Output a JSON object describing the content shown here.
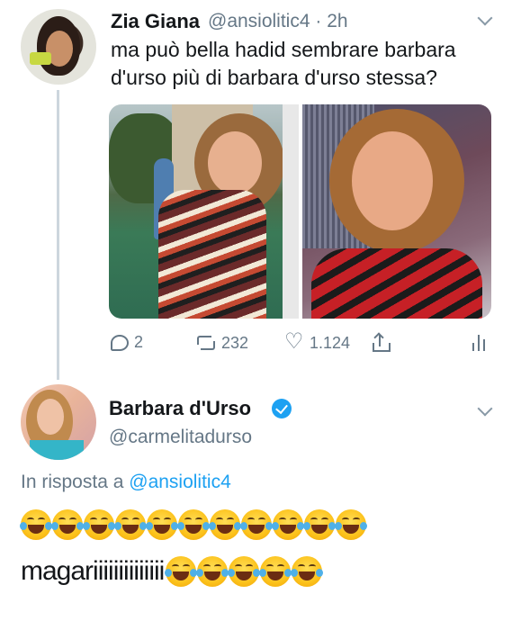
{
  "tweet1": {
    "author_name": "Zia Giana",
    "handle": "@ansiolitic4",
    "separator": "·",
    "time": "2h",
    "text": "ma può bella hadid sembrare barbara d'urso più di barbara d'urso stessa?",
    "stats": {
      "replies": "2",
      "retweets": "232",
      "likes": "1.124"
    }
  },
  "tweet2": {
    "author_name": "Barbara d'Urso",
    "handle": "@carmelitadurso",
    "verified": true,
    "reply_prefix": "In risposta a",
    "reply_mention": "@ansiolitic4",
    "emoji_line_count": 11,
    "last_line_text": "magariiiiiiiiiiiiii",
    "last_line_emoji_count": 5
  },
  "colors": {
    "text": "#14171a",
    "muted": "#657786",
    "link": "#1da1f2",
    "thread_line": "#ccd6dd"
  },
  "icons": [
    "chevron-down-icon",
    "reply-icon",
    "retweet-icon",
    "like-icon",
    "share-icon",
    "analytics-icon",
    "verified-badge-icon",
    "face-with-tears-of-joy-emoji"
  ]
}
